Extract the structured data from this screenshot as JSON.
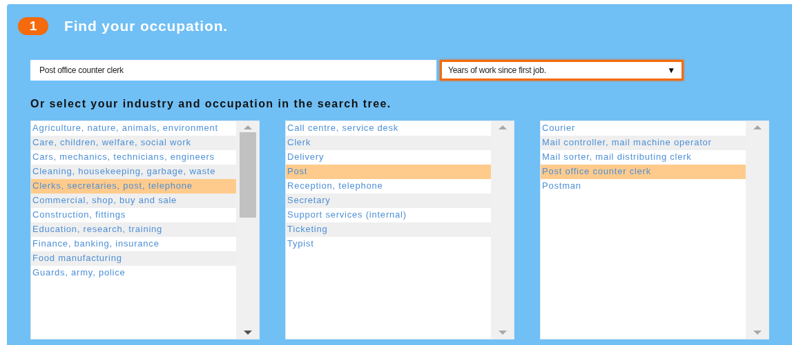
{
  "step": {
    "number": "1",
    "title": "Find your occupation."
  },
  "search": {
    "value": "Post office counter clerk"
  },
  "experience_select": {
    "value": "Years of work since first job.",
    "arrow": "▼"
  },
  "tree_heading": "Or select your industry and occupation in the search tree.",
  "lists": [
    {
      "has_thumb": true,
      "items": [
        {
          "label": "Agriculture, nature, animals, environment",
          "selected": false
        },
        {
          "label": "Care, children, welfare, social work",
          "selected": false
        },
        {
          "label": "Cars, mechanics, technicians, engineers",
          "selected": false
        },
        {
          "label": "Cleaning, housekeeping, garbage, waste",
          "selected": false
        },
        {
          "label": "Clerks, secretaries, post, telephone",
          "selected": true
        },
        {
          "label": "Commercial, shop, buy and sale",
          "selected": false
        },
        {
          "label": "Construction, fittings",
          "selected": false
        },
        {
          "label": "Education, research, training",
          "selected": false
        },
        {
          "label": "Finance, banking, insurance",
          "selected": false
        },
        {
          "label": "Food manufacturing",
          "selected": false
        },
        {
          "label": "Guards, army, police",
          "selected": false
        }
      ]
    },
    {
      "has_thumb": false,
      "items": [
        {
          "label": "Call centre, service desk",
          "selected": false
        },
        {
          "label": "Clerk",
          "selected": false
        },
        {
          "label": "Delivery",
          "selected": false
        },
        {
          "label": "Post",
          "selected": true
        },
        {
          "label": "Reception, telephone",
          "selected": false
        },
        {
          "label": "Secretary",
          "selected": false
        },
        {
          "label": "Support services (internal)",
          "selected": false
        },
        {
          "label": "Ticketing",
          "selected": false
        },
        {
          "label": "Typist",
          "selected": false
        }
      ]
    },
    {
      "has_thumb": false,
      "items": [
        {
          "label": "Courier",
          "selected": false
        },
        {
          "label": "Mail controller, mail machine operator",
          "selected": false
        },
        {
          "label": "Mail sorter, mail distributing clerk",
          "selected": false
        },
        {
          "label": "Post office counter clerk",
          "selected": true
        },
        {
          "label": "Postman",
          "selected": false
        }
      ]
    }
  ]
}
